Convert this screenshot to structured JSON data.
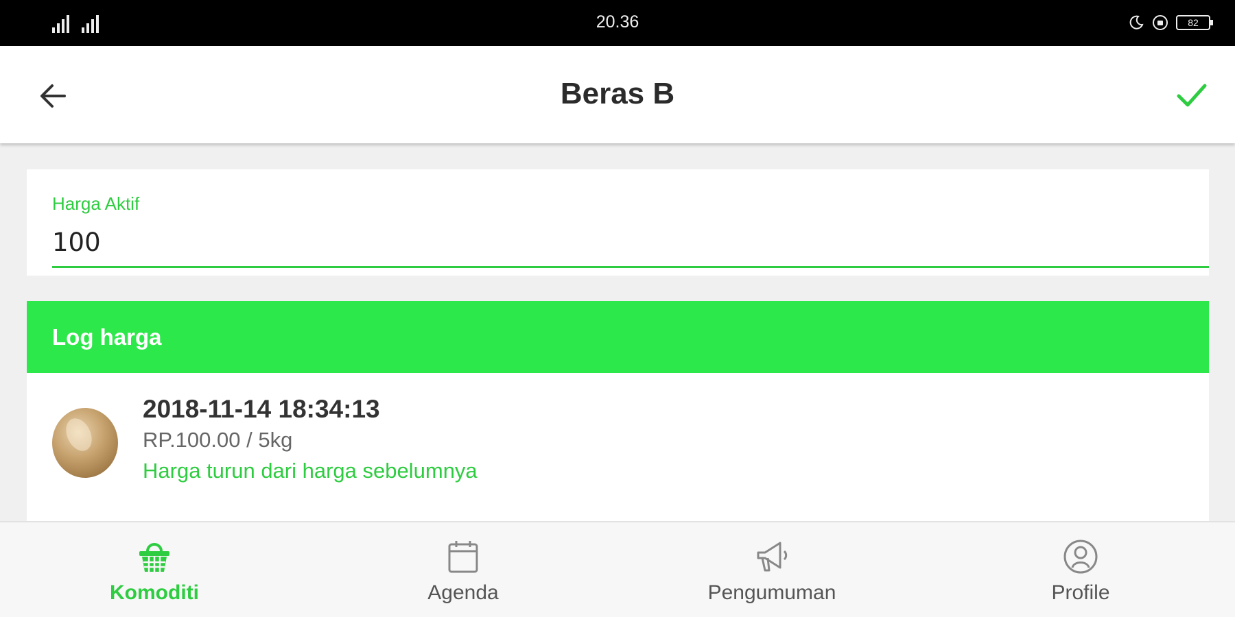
{
  "status_bar": {
    "time": "20.36",
    "battery": "82"
  },
  "app_bar": {
    "title": "Beras B",
    "back_icon": "arrow-left-icon",
    "confirm_icon": "check-icon"
  },
  "price_field": {
    "label": "Harga Aktif",
    "value": "100"
  },
  "log": {
    "header": "Log harga",
    "items": [
      {
        "date": "2018-11-14 18:34:13",
        "price": "RP.100.00 / 5kg",
        "note": "Harga turun dari harga sebelumnya"
      }
    ]
  },
  "bottom_nav": {
    "active": "Komoditi",
    "items": [
      {
        "label": "Komoditi",
        "icon": "basket-icon"
      },
      {
        "label": "Agenda",
        "icon": "calendar-icon"
      },
      {
        "label": "Pengumuman",
        "icon": "megaphone-icon"
      },
      {
        "label": "Profile",
        "icon": "user-icon"
      }
    ]
  },
  "colors": {
    "accent": "#2ecc40",
    "log_header_bg": "#2de84a",
    "status_bar_bg": "#000000"
  }
}
